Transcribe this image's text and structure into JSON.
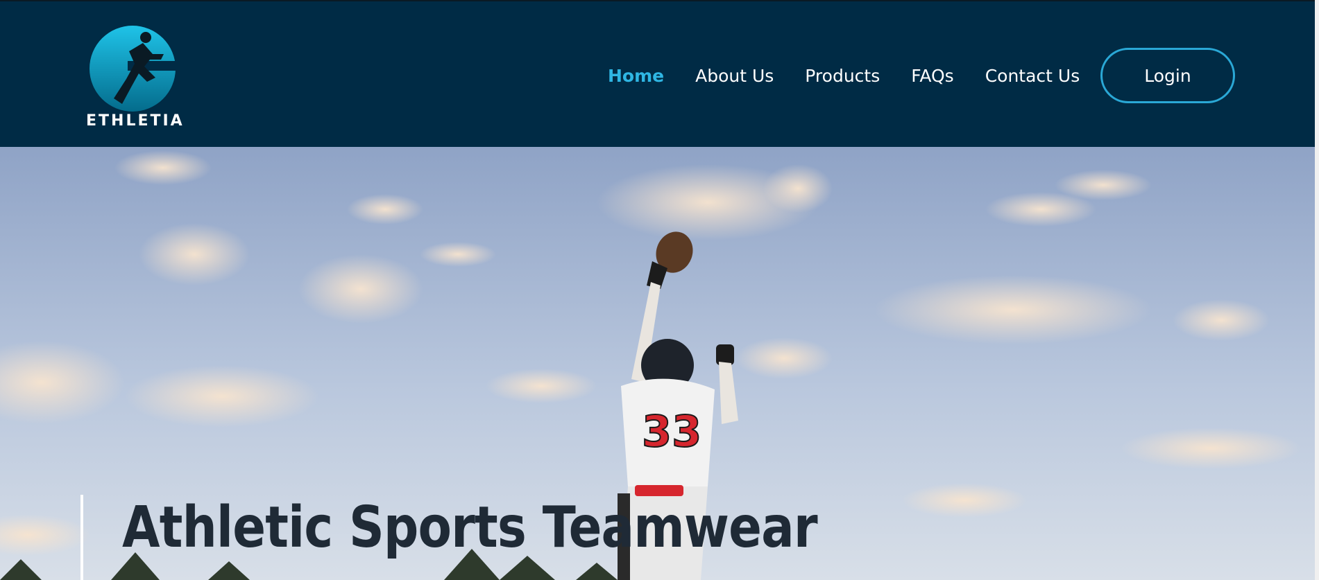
{
  "brand": {
    "name": "ETHLETIA",
    "logo_icon": "running-athlete-logo"
  },
  "nav": {
    "items": [
      {
        "label": "Home",
        "active": true
      },
      {
        "label": "About Us",
        "active": false
      },
      {
        "label": "Products",
        "active": false
      },
      {
        "label": "FAQs",
        "active": false
      },
      {
        "label": "Contact Us",
        "active": false
      }
    ],
    "login_label": "Login"
  },
  "hero": {
    "title": "Athletic Sports Teamwear",
    "jersey_number": "33"
  },
  "colors": {
    "header_bg": "#002b45",
    "accent": "#2fb6e3",
    "title_text": "#1f2a36"
  }
}
